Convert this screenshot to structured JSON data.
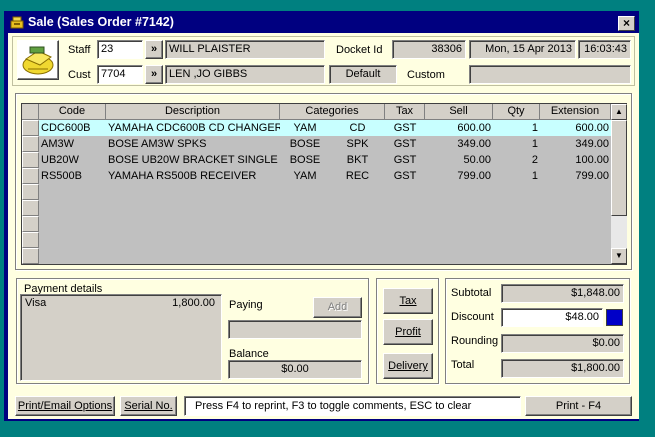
{
  "window": {
    "title": "Sale (Sales Order #7142)",
    "close_label": "×"
  },
  "header": {
    "staff_label": "Staff",
    "staff_code": "23",
    "staff_lookup": "»",
    "staff_name": "WILL  PLAISTER",
    "cust_label": "Cust",
    "cust_code": "7704",
    "cust_lookup": "»",
    "cust_name": "LEN ,JO GIBBS",
    "docket_label": "Docket Id",
    "docket_id": "38306",
    "date": "Mon, 15 Apr 2013",
    "time": "16:03:43",
    "price_level": "Default",
    "custom_label": "Custom",
    "custom_value": ""
  },
  "grid": {
    "columns": [
      "Code",
      "Description",
      "Categories",
      "Tax",
      "Sell",
      "Qty",
      "Extension"
    ],
    "rows": [
      {
        "code": "CDC600B",
        "description": "YAMAHA CDC600B CD CHANGER",
        "cat1": "YAM",
        "cat2": "CD",
        "tax": "GST",
        "sell": "600.00",
        "qty": "1",
        "extension": "600.00",
        "selected": true
      },
      {
        "code": "AM3W",
        "description": "BOSE AM3W SPKS",
        "cat1": "BOSE",
        "cat2": "SPK",
        "tax": "GST",
        "sell": "349.00",
        "qty": "1",
        "extension": "349.00",
        "selected": false
      },
      {
        "code": "UB20W",
        "description": "BOSE UB20W BRACKET SINGLE",
        "cat1": "BOSE",
        "cat2": "BKT",
        "tax": "GST",
        "sell": "50.00",
        "qty": "2",
        "extension": "100.00",
        "selected": false
      },
      {
        "code": "RS500B",
        "description": "YAMAHA RS500B RECEIVER",
        "cat1": "YAM",
        "cat2": "REC",
        "tax": "GST",
        "sell": "799.00",
        "qty": "1",
        "extension": "799.00",
        "selected": false
      }
    ]
  },
  "payment": {
    "group_label": "Payment details",
    "method": "Visa",
    "amount": "1,800.00",
    "paying_label": "Paying",
    "add_label": "Add",
    "paying_value": "",
    "balance_label": "Balance",
    "balance_value": "$0.00"
  },
  "actions": {
    "tax_label": "Tax",
    "profit_label": "Profit",
    "delivery_label": "Delivery"
  },
  "totals": {
    "subtotal_label": "Subtotal",
    "subtotal_value": "$1,848.00",
    "discount_label": "Discount",
    "discount_value": "$48.00",
    "rounding_label": "Rounding",
    "rounding_value": "$0.00",
    "total_label": "Total",
    "total_value": "$1,800.00"
  },
  "footer": {
    "print_email_label": "Print/Email Options",
    "serial_label": "Serial No.",
    "status_text": "Press F4 to reprint, F3 to toggle comments, ESC to clear",
    "print_label": "Print - F4"
  },
  "colors": {
    "desktop": "#008080",
    "titlebar": "#000080",
    "panel": "#ffffe1",
    "selected_row": "#c8ffff",
    "discount_swatch": "#0000c8"
  }
}
